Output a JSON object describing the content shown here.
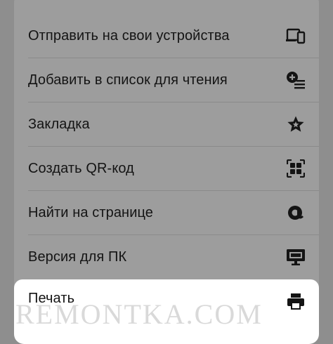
{
  "menu": {
    "items": [
      {
        "label": "Отправить на свои устройства",
        "icon": "send-to-devices-icon"
      },
      {
        "label": "Добавить в список для чтения",
        "icon": "reading-list-add-icon"
      },
      {
        "label": "Закладка",
        "icon": "bookmark-star-icon"
      },
      {
        "label": "Создать QR-код",
        "icon": "qr-code-icon"
      },
      {
        "label": "Найти на странице",
        "icon": "find-in-page-icon"
      },
      {
        "label": "Версия для ПК",
        "icon": "desktop-site-icon"
      },
      {
        "label": "Печать",
        "icon": "print-icon"
      }
    ]
  },
  "watermark": "REMONTKA.COM",
  "colors": {
    "overlay_background": "#8e8e8e",
    "sheet_background": "#9d9d9d",
    "highlight_background": "#ffffff",
    "text": "#141414"
  }
}
